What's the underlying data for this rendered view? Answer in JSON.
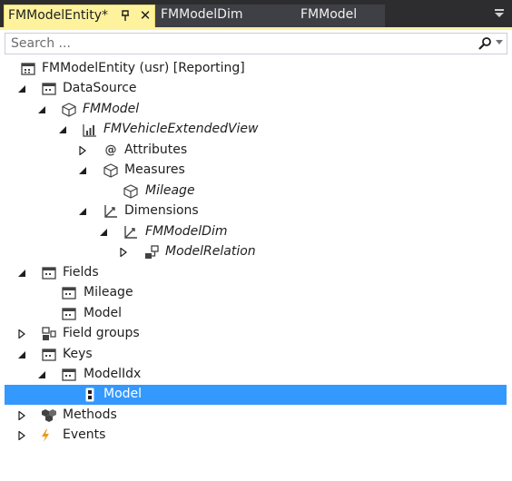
{
  "tabs": {
    "active": {
      "label": "FMModelEntity*"
    },
    "others": [
      {
        "label": "FMModelDim"
      },
      {
        "label": "FMModel"
      }
    ]
  },
  "search": {
    "placeholder": "Search ..."
  },
  "tree": {
    "root": "FMModelEntity (usr) [Reporting]",
    "datasource": "DataSource",
    "fmmodel": "FMModel",
    "view": "FMVehicleExtendedView",
    "attributes": "Attributes",
    "measures": "Measures",
    "mileage_measure": "Mileage",
    "dimensions": "Dimensions",
    "fmmodeldim": "FMModelDim",
    "modelrelation": "ModelRelation",
    "fields": "Fields",
    "field_mileage": "Mileage",
    "field_model": "Model",
    "field_groups": "Field groups",
    "keys": "Keys",
    "modelidx": "ModelIdx",
    "key_model": "Model",
    "methods": "Methods",
    "events": "Events"
  },
  "colors": {
    "active_tab": "#fff29d",
    "selection": "#3399ff",
    "chrome": "#2d2d30"
  }
}
